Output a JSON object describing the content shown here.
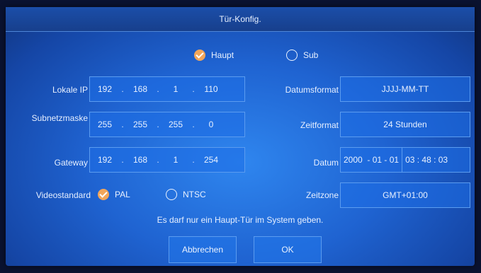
{
  "title": "Tür-Konfig.",
  "mode": {
    "haupt": "Haupt",
    "sub": "Sub",
    "selected": "Haupt"
  },
  "fields": {
    "local_ip": {
      "label": "Lokale IP",
      "octets": [
        "192",
        "168",
        "1",
        "110"
      ]
    },
    "subnet": {
      "label": "Subnetzmaske",
      "octets": [
        "255",
        "255",
        "255",
        "0"
      ]
    },
    "gateway": {
      "label": "Gateway",
      "octets": [
        "192",
        "168",
        "1",
        "254"
      ]
    }
  },
  "video": {
    "label": "Videostandard",
    "pal": "PAL",
    "ntsc": "NTSC",
    "selected": "PAL"
  },
  "right": {
    "dateformat_label": "Datumsformat",
    "dateformat_value": "JJJJ-MM-TT",
    "timeformat_label": "Zeitformat",
    "timeformat_value": "24 Stunden",
    "date_label": "Datum",
    "date_value": "2000  - 01 - 01",
    "time_value": "03 : 48 : 03",
    "timezone_label": "Zeitzone",
    "timezone_value": "GMT+01:00"
  },
  "note": "Es darf nur ein Haupt-Tür im System geben.",
  "buttons": {
    "cancel": "Abbrechen",
    "ok": "OK"
  }
}
